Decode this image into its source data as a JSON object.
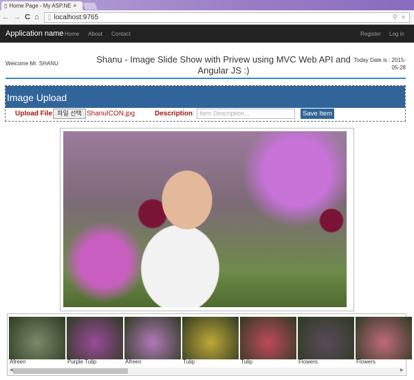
{
  "browser": {
    "tab_title": "Home Page - My ASP.NE",
    "url": "localhost:9765"
  },
  "nav": {
    "brand": "Application name",
    "links": [
      "Home",
      "About",
      "Contact"
    ],
    "right": [
      "Register",
      "Log in"
    ]
  },
  "header": {
    "welcome": "Welcome Mr. SHANU",
    "title": "Shanu - Image Slide Show with Privew using MVC Web API and Angular JS :)",
    "date": "Today Date is : 2015-05-28"
  },
  "upload": {
    "heading": "Image Upload",
    "file_label": "Upload File",
    "file_button": "파일 선택",
    "file_name": "ShanuICON.jpg",
    "desc_label": "Description",
    "colon": ":",
    "desc_placeholder": "Item Description...",
    "save_label": "Save Item"
  },
  "thumbnails": [
    {
      "label": "Afreen",
      "color": "#7a8a6a"
    },
    {
      "label": "Purple Tulip",
      "color": "#9a4a9a"
    },
    {
      "label": "Afreen",
      "color": "#b07ab8"
    },
    {
      "label": "Tulip",
      "color": "#c0a838"
    },
    {
      "label": "Tulip",
      "color": "#c04a5a"
    },
    {
      "label": "Flowers",
      "color": "#5a4a5a"
    },
    {
      "label": "Flowers",
      "color": "#c06a7a"
    }
  ]
}
